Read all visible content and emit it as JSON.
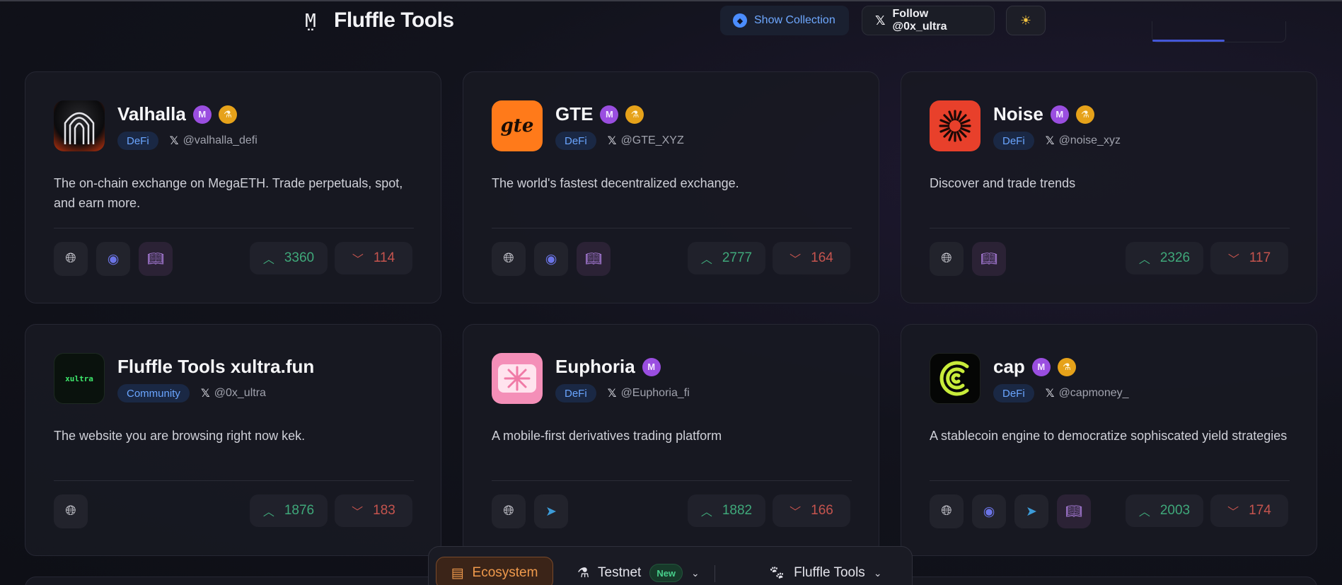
{
  "header": {
    "logo_glyph": "M̤",
    "brand": "Fluffle Tools",
    "show_collection": "Show Collection",
    "follow": "Follow @0x_ultra",
    "theme_icon": "sun-icon"
  },
  "projects": [
    {
      "name": "Valhalla",
      "category": "DeFi",
      "handle": "@valhalla_defi",
      "description": "The on-chain exchange on MegaETH. Trade perpetuals, spot, and earn more.",
      "up": "3360",
      "down": "114",
      "badges": [
        "mega",
        "test"
      ],
      "links": [
        "website",
        "discord",
        "docs"
      ]
    },
    {
      "name": "GTE",
      "category": "DeFi",
      "handle": "@GTE_XYZ",
      "description": "The world's fastest decentralized exchange.",
      "up": "2777",
      "down": "164",
      "badges": [
        "mega",
        "test"
      ],
      "links": [
        "website",
        "discord",
        "docs"
      ]
    },
    {
      "name": "Noise",
      "category": "DeFi",
      "handle": "@noise_xyz",
      "description": "Discover and trade trends",
      "up": "2326",
      "down": "117",
      "badges": [
        "mega",
        "test"
      ],
      "links": [
        "website",
        "docs"
      ]
    },
    {
      "name": "Fluffle Tools xultra.fun",
      "category": "Community",
      "handle": "@0x_ultra",
      "description": "The website you are browsing right now kek.",
      "up": "1876",
      "down": "183",
      "badges": [],
      "links": [
        "website"
      ]
    },
    {
      "name": "Euphoria",
      "category": "DeFi",
      "handle": "@Euphoria_fi",
      "description": "A mobile-first derivatives trading platform",
      "up": "1882",
      "down": "166",
      "badges": [
        "mega"
      ],
      "links": [
        "website",
        "telegram"
      ]
    },
    {
      "name": "cap",
      "category": "DeFi",
      "handle": "@capmoney_",
      "description": "A stablecoin engine to democratize sophiscated yield strategies",
      "up": "2003",
      "down": "174",
      "badges": [
        "mega",
        "test"
      ],
      "links": [
        "website",
        "discord",
        "telegram",
        "docs"
      ]
    }
  ],
  "project_logo_texts": {
    "gte": "gte",
    "xultra": "xultra"
  },
  "bottom_nav": {
    "ecosystem": "Ecosystem",
    "testnet": "Testnet",
    "new_badge": "New",
    "tools": "Fluffle Tools"
  },
  "colors": {
    "accent_blue": "#6aa5ff",
    "up_green": "#3fa87a",
    "down_red": "#c5544e",
    "eco_orange": "#f09a4c"
  }
}
